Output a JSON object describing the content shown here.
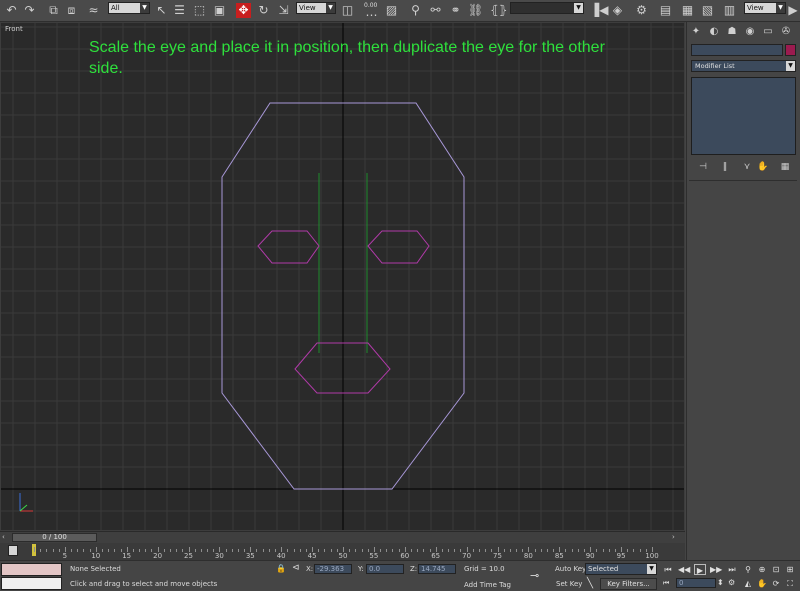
{
  "toolbar": {
    "selection_filter": "All",
    "reference_coord": "View",
    "spinner_value": "0.00",
    "named_selection": "",
    "render_view": "View"
  },
  "viewport": {
    "label": "Front",
    "instruction": "Scale the eye and place it in position, then duplicate the eye for the other side.",
    "colors": {
      "background": "#2a2a2a",
      "grid_minor": "#3a3a3a",
      "grid_major": "#000000",
      "head_outline": "#a898d8",
      "features_outline": "#b03aa8",
      "guide_lines": "#1d8a2c",
      "instruction_text": "#2ee03c"
    }
  },
  "command_panel": {
    "object_name": "",
    "object_color": "#9b1b4f",
    "modifier_list_label": "Modifier List"
  },
  "timeline": {
    "frame_display": "0 / 100",
    "ticks": [
      "0",
      "5",
      "10",
      "15",
      "20",
      "25",
      "30",
      "35",
      "40",
      "45",
      "50",
      "55",
      "60",
      "65",
      "70",
      "75",
      "80",
      "85",
      "90",
      "95",
      "100"
    ]
  },
  "status": {
    "selection": "None Selected",
    "prompt": "Click and drag to select and move objects",
    "x_label": "X:",
    "x_value": "-29.363",
    "y_label": "Y:",
    "y_value": "0.0",
    "z_label": "Z:",
    "z_value": "14.745",
    "grid": "Grid = 10.0",
    "add_time_tag": "Add Time Tag",
    "auto_key": "Auto Key",
    "key_mode": "Selected",
    "set_key": "Set Key",
    "key_filters": "Key Filters...",
    "current_frame": "0"
  }
}
